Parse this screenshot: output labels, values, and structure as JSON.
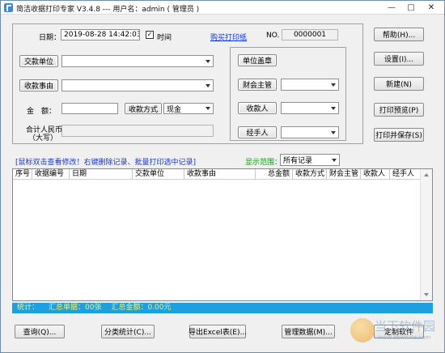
{
  "window": {
    "title": "简洁收据打印专家 V3.4.8 --- 用户名：admin ( 管理员 )",
    "minimize_glyph": "—",
    "maximize_glyph": "□",
    "close_glyph": "✕"
  },
  "form": {
    "date_label": "日期：",
    "date_value": "2019-08-28 14:42:03",
    "time_checkbox_checked": true,
    "time_label": "时间",
    "buy_link": "购买打印纸",
    "no_label": "NO.",
    "no_value": "0000001",
    "payer_button": "交款单位",
    "payer_value": "",
    "reason_button": "收款事由",
    "reason_value": "",
    "amount_label": "金　额：",
    "amount_value": "",
    "pay_method_button": "收款方式",
    "pay_method_value": "现金",
    "rmb_label_line1": "合计人民币",
    "rmb_label_line2": "（大写）",
    "rmb_value": "",
    "seal_button": "单位盖章",
    "accountant_button": "财会主管",
    "accountant_value": "",
    "receiver_button": "收款人",
    "receiver_value": "",
    "handler_button": "经手人",
    "handler_value": ""
  },
  "right_buttons": {
    "help": "帮助(H)...",
    "settings": "设置(I)...",
    "new": "新建(N)",
    "preview": "打印预览(P)",
    "print_save": "打印并保存(S)"
  },
  "list": {
    "hint": "[鼠标双击查看修改！右键删除记录、批量打印选中记录]",
    "range_label": "显示范围：",
    "range_value": "所有记录",
    "columns": [
      "序号",
      "收据编号",
      "日期",
      "交款单位",
      "收款事由",
      "总金额",
      "收款方式",
      "财会主管",
      "收款人",
      "经手人"
    ]
  },
  "status": {
    "label": "统计：",
    "count_text": "汇总单据：00张",
    "total_text": "汇总金额：0.00元"
  },
  "bottom_buttons": {
    "query": "查询(Q)...",
    "category_stats": "分类统计(C)...",
    "export_excel": "导出Excel表(E)...",
    "manage_data": "管理数据(M)...",
    "customize": "定制软件"
  },
  "watermark": {
    "name": "当下软件园",
    "url": "www.downxia.com"
  },
  "colors": {
    "status_bg": "#1d9fe0",
    "status_text": "#ffef5a",
    "hint_text": "#1a36c8",
    "range_label": "#119911",
    "link": "#1030d0"
  }
}
